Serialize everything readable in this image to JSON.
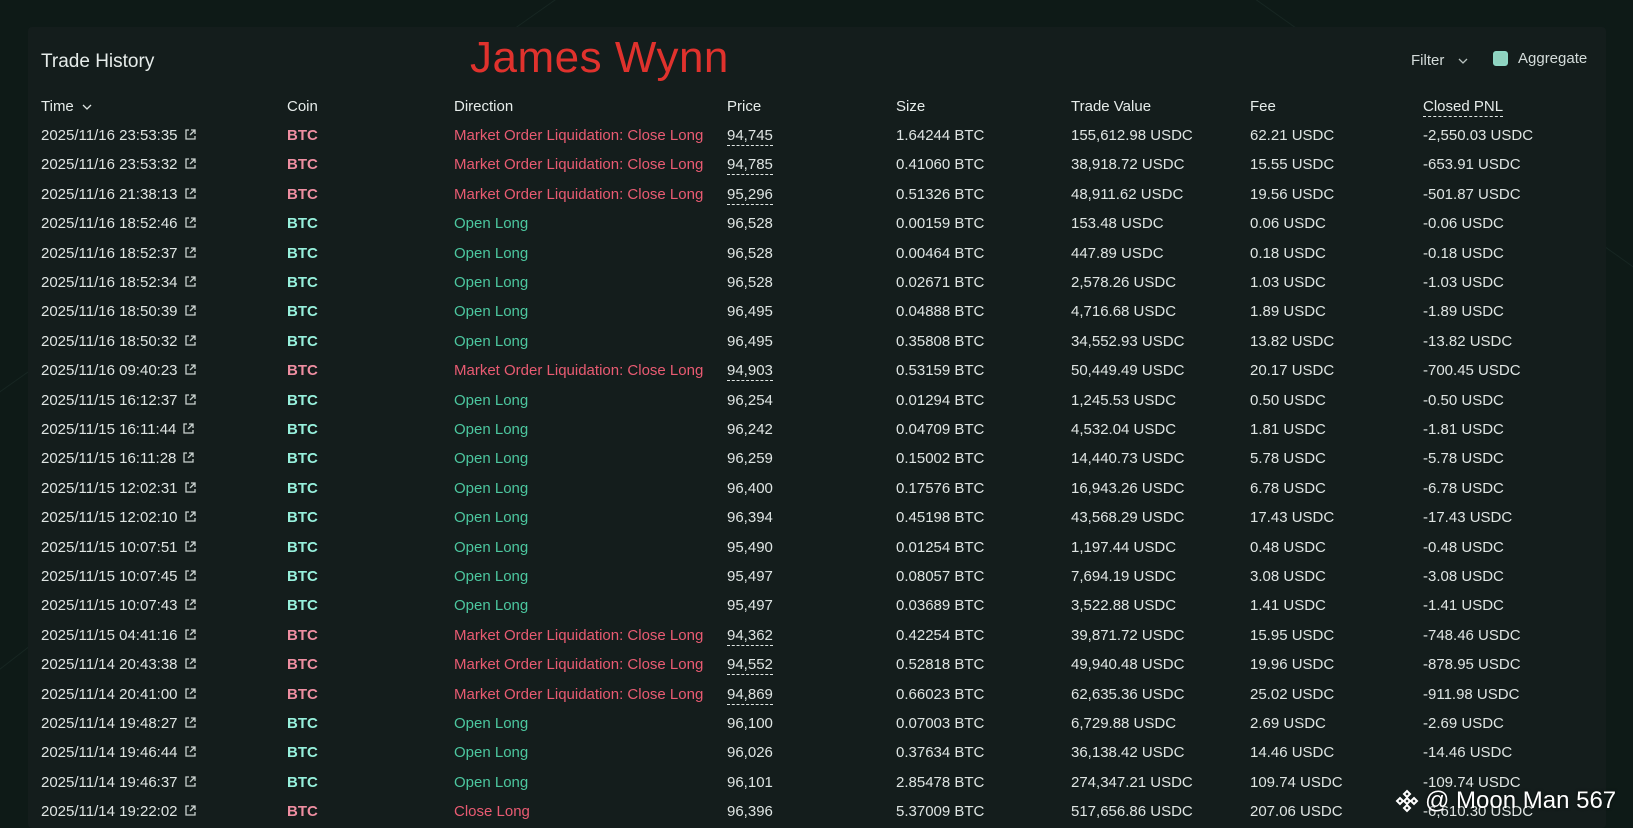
{
  "header": {
    "title": "Trade History",
    "banner": "James Wynn",
    "filter_label": "Filter",
    "aggregate_label": "Aggregate",
    "aggregate_checked": true
  },
  "columns": {
    "time": "Time",
    "coin": "Coin",
    "direction": "Direction",
    "price": "Price",
    "size": "Size",
    "trade_value": "Trade Value",
    "fee": "Fee",
    "closed_pnl": "Closed PNL"
  },
  "colors": {
    "long_direction": "#4cc79f",
    "short_direction": "#e95b72",
    "banner": "#e0322d",
    "panel": "#141d1c"
  },
  "rows": [
    {
      "time": "2025/11/16 23:53:35",
      "coin": "BTC",
      "direction": "Market Order Liquidation: Close Long",
      "side": "short",
      "price": "94,745",
      "price_underline": true,
      "size": "1.64244 BTC",
      "value": "155,612.98 USDC",
      "fee": "62.21 USDC",
      "pnl": "-2,550.03 USDC"
    },
    {
      "time": "2025/11/16 23:53:32",
      "coin": "BTC",
      "direction": "Market Order Liquidation: Close Long",
      "side": "short",
      "price": "94,785",
      "price_underline": true,
      "size": "0.41060 BTC",
      "value": "38,918.72 USDC",
      "fee": "15.55 USDC",
      "pnl": "-653.91 USDC"
    },
    {
      "time": "2025/11/16 21:38:13",
      "coin": "BTC",
      "direction": "Market Order Liquidation: Close Long",
      "side": "short",
      "price": "95,296",
      "price_underline": true,
      "size": "0.51326 BTC",
      "value": "48,911.62 USDC",
      "fee": "19.56 USDC",
      "pnl": "-501.87 USDC"
    },
    {
      "time": "2025/11/16 18:52:46",
      "coin": "BTC",
      "direction": "Open Long",
      "side": "long",
      "price": "96,528",
      "price_underline": false,
      "size": "0.00159 BTC",
      "value": "153.48 USDC",
      "fee": "0.06 USDC",
      "pnl": "-0.06 USDC"
    },
    {
      "time": "2025/11/16 18:52:37",
      "coin": "BTC",
      "direction": "Open Long",
      "side": "long",
      "price": "96,528",
      "price_underline": false,
      "size": "0.00464 BTC",
      "value": "447.89 USDC",
      "fee": "0.18 USDC",
      "pnl": "-0.18 USDC"
    },
    {
      "time": "2025/11/16 18:52:34",
      "coin": "BTC",
      "direction": "Open Long",
      "side": "long",
      "price": "96,528",
      "price_underline": false,
      "size": "0.02671 BTC",
      "value": "2,578.26 USDC",
      "fee": "1.03 USDC",
      "pnl": "-1.03 USDC"
    },
    {
      "time": "2025/11/16 18:50:39",
      "coin": "BTC",
      "direction": "Open Long",
      "side": "long",
      "price": "96,495",
      "price_underline": false,
      "size": "0.04888 BTC",
      "value": "4,716.68 USDC",
      "fee": "1.89 USDC",
      "pnl": "-1.89 USDC"
    },
    {
      "time": "2025/11/16 18:50:32",
      "coin": "BTC",
      "direction": "Open Long",
      "side": "long",
      "price": "96,495",
      "price_underline": false,
      "size": "0.35808 BTC",
      "value": "34,552.93 USDC",
      "fee": "13.82 USDC",
      "pnl": "-13.82 USDC"
    },
    {
      "time": "2025/11/16 09:40:23",
      "coin": "BTC",
      "direction": "Market Order Liquidation: Close Long",
      "side": "short",
      "price": "94,903",
      "price_underline": true,
      "size": "0.53159 BTC",
      "value": "50,449.49 USDC",
      "fee": "20.17 USDC",
      "pnl": "-700.45 USDC"
    },
    {
      "time": "2025/11/15 16:12:37",
      "coin": "BTC",
      "direction": "Open Long",
      "side": "long",
      "price": "96,254",
      "price_underline": false,
      "size": "0.01294 BTC",
      "value": "1,245.53 USDC",
      "fee": "0.50 USDC",
      "pnl": "-0.50 USDC"
    },
    {
      "time": "2025/11/15 16:11:44",
      "coin": "BTC",
      "direction": "Open Long",
      "side": "long",
      "price": "96,242",
      "price_underline": false,
      "size": "0.04709 BTC",
      "value": "4,532.04 USDC",
      "fee": "1.81 USDC",
      "pnl": "-1.81 USDC"
    },
    {
      "time": "2025/11/15 16:11:28",
      "coin": "BTC",
      "direction": "Open Long",
      "side": "long",
      "price": "96,259",
      "price_underline": false,
      "size": "0.15002 BTC",
      "value": "14,440.73 USDC",
      "fee": "5.78 USDC",
      "pnl": "-5.78 USDC"
    },
    {
      "time": "2025/11/15 12:02:31",
      "coin": "BTC",
      "direction": "Open Long",
      "side": "long",
      "price": "96,400",
      "price_underline": false,
      "size": "0.17576 BTC",
      "value": "16,943.26 USDC",
      "fee": "6.78 USDC",
      "pnl": "-6.78 USDC"
    },
    {
      "time": "2025/11/15 12:02:10",
      "coin": "BTC",
      "direction": "Open Long",
      "side": "long",
      "price": "96,394",
      "price_underline": false,
      "size": "0.45198 BTC",
      "value": "43,568.29 USDC",
      "fee": "17.43 USDC",
      "pnl": "-17.43 USDC"
    },
    {
      "time": "2025/11/15 10:07:51",
      "coin": "BTC",
      "direction": "Open Long",
      "side": "long",
      "price": "95,490",
      "price_underline": false,
      "size": "0.01254 BTC",
      "value": "1,197.44 USDC",
      "fee": "0.48 USDC",
      "pnl": "-0.48 USDC"
    },
    {
      "time": "2025/11/15 10:07:45",
      "coin": "BTC",
      "direction": "Open Long",
      "side": "long",
      "price": "95,497",
      "price_underline": false,
      "size": "0.08057 BTC",
      "value": "7,694.19 USDC",
      "fee": "3.08 USDC",
      "pnl": "-3.08 USDC"
    },
    {
      "time": "2025/11/15 10:07:43",
      "coin": "BTC",
      "direction": "Open Long",
      "side": "long",
      "price": "95,497",
      "price_underline": false,
      "size": "0.03689 BTC",
      "value": "3,522.88 USDC",
      "fee": "1.41 USDC",
      "pnl": "-1.41 USDC"
    },
    {
      "time": "2025/11/15 04:41:16",
      "coin": "BTC",
      "direction": "Market Order Liquidation: Close Long",
      "side": "short",
      "price": "94,362",
      "price_underline": true,
      "size": "0.42254 BTC",
      "value": "39,871.72 USDC",
      "fee": "15.95 USDC",
      "pnl": "-748.46 USDC"
    },
    {
      "time": "2025/11/14 20:43:38",
      "coin": "BTC",
      "direction": "Market Order Liquidation: Close Long",
      "side": "short",
      "price": "94,552",
      "price_underline": true,
      "size": "0.52818 BTC",
      "value": "49,940.48 USDC",
      "fee": "19.96 USDC",
      "pnl": "-878.95 USDC"
    },
    {
      "time": "2025/11/14 20:41:00",
      "coin": "BTC",
      "direction": "Market Order Liquidation: Close Long",
      "side": "short",
      "price": "94,869",
      "price_underline": true,
      "size": "0.66023 BTC",
      "value": "62,635.36 USDC",
      "fee": "25.02 USDC",
      "pnl": "-911.98 USDC"
    },
    {
      "time": "2025/11/14 19:48:27",
      "coin": "BTC",
      "direction": "Open Long",
      "side": "long",
      "price": "96,100",
      "price_underline": false,
      "size": "0.07003 BTC",
      "value": "6,729.88 USDC",
      "fee": "2.69 USDC",
      "pnl": "-2.69 USDC"
    },
    {
      "time": "2025/11/14 19:46:44",
      "coin": "BTC",
      "direction": "Open Long",
      "side": "long",
      "price": "96,026",
      "price_underline": false,
      "size": "0.37634 BTC",
      "value": "36,138.42 USDC",
      "fee": "14.46 USDC",
      "pnl": "-14.46 USDC"
    },
    {
      "time": "2025/11/14 19:46:37",
      "coin": "BTC",
      "direction": "Open Long",
      "side": "long",
      "price": "96,101",
      "price_underline": false,
      "size": "2.85478 BTC",
      "value": "274,347.21 USDC",
      "fee": "109.74 USDC",
      "pnl": "-109.74 USDC"
    },
    {
      "time": "2025/11/14 19:22:02",
      "coin": "BTC",
      "direction": "Close Long",
      "side": "short",
      "price": "96,396",
      "price_underline": false,
      "size": "5.37009 BTC",
      "value": "517,656.86 USDC",
      "fee": "207.06 USDC",
      "pnl": "-6,610.30 USDC"
    }
  ],
  "watermark": {
    "text": "@ Moon Man 567",
    "icon": "binance-diamond-icon"
  }
}
